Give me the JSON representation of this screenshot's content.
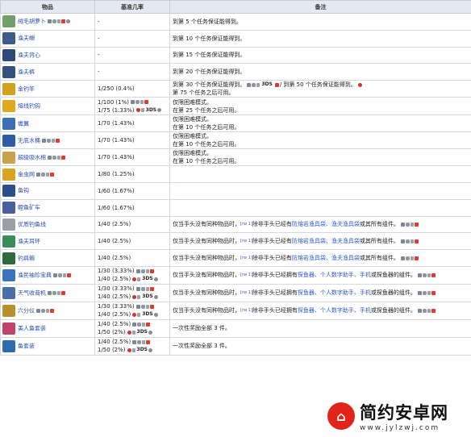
{
  "headers": {
    "item": "物品",
    "rate": "基准几率",
    "notes": "备注"
  },
  "rows": [
    {
      "name": "绒毛胡萝卜",
      "sprite_color": "#6fa06a",
      "plats": [
        "pc",
        "con",
        "mob",
        "sw",
        "gear"
      ],
      "rate1": "-",
      "note1": "到第 5 个任务保证能得到。"
    },
    {
      "name": "渔夫帽",
      "sprite_color": "#3d5a8c",
      "plats": [],
      "rate1": "-",
      "note1": "到第 10 个任务保证能得到。"
    },
    {
      "name": "渔夫背心",
      "sprite_color": "#2f4a7a",
      "plats": [],
      "rate1": "-",
      "note1": "到第 15 个任务保证能得到。"
    },
    {
      "name": "渔夫裤",
      "sprite_color": "#34507e",
      "plats": [],
      "rate1": "-",
      "note1": "到第 20 个任务保证能得到。"
    },
    {
      "name": "金钓竿",
      "sprite_color": "#d4a11c",
      "plats": [],
      "rate1": "1/250 (0.4%)",
      "note1": "到第 30 个任务保证能得到。",
      "note1b": "/ 到第 50 个任务保证能得到。",
      "note2": "第 75 个任务之后可用。"
    },
    {
      "name": "熔线钓钩",
      "sprite_color": "#e0a820",
      "plats": [],
      "rate1": "1/100 (1%)",
      "rate2": "1/75 (1.33%)",
      "note1": "仅限困难模式。",
      "note2": "在第 25 个任务之后可用。"
    },
    {
      "name": "蟾翼",
      "sprite_color": "#3c6fb8",
      "plats": [],
      "rate1": "1/70 (1.43%)",
      "note1": "仅限困难模式。",
      "note2": "在第 10 个任务之后可用。"
    },
    {
      "name": "无底水桶",
      "sprite_color": "#2d5ba8",
      "plats": [
        "pc",
        "con",
        "mob",
        "sw"
      ],
      "rate1": "1/70 (1.43%)",
      "note1": "仅限困难模式。",
      "note2": "在第 10 个任务之后可用。"
    },
    {
      "name": "超级吸水棉",
      "sprite_color": "#c9a24a",
      "plats": [
        "pc",
        "con",
        "mob",
        "sw"
      ],
      "rate1": "1/70 (1.43%)",
      "note1": "仅限困难模式。",
      "note2": "在第 10 个任务之后可用。"
    },
    {
      "name": "金虫网",
      "sprite_color": "#d9a520",
      "plats": [
        "pc",
        "con",
        "mob",
        "sw"
      ],
      "rate1": "1/80 (1.25%)"
    },
    {
      "name": "鱼钩",
      "sprite_color": "#2b4f8a",
      "plats": [],
      "rate1": "1/60 (1.67%)"
    },
    {
      "name": "鲤鱼矿车",
      "sprite_color": "#4a5fa0",
      "plats": [],
      "rate1": "1/60 (1.67%)"
    },
    {
      "name": "优质钓鱼线",
      "sprite_color": "#9aa0a6",
      "plats": [],
      "rate1": "1/40 (2.5%)",
      "note1": "仅当手头没有同种物品时，",
      "note_sup": "[rw 1]",
      "note_mid": "除非手头已经有",
      "note_link": "防熔岩渔具袋、渔夫渔具袋",
      "note_tail": "或其所有组件。"
    },
    {
      "name": "渔夫耳环",
      "sprite_color": "#3b8c5a",
      "plats": [],
      "rate1": "1/40 (2.5%)",
      "note1": "仅当手头没有同种物品时，",
      "note_sup": "[rw 1]",
      "note_mid": "除非手头已经有",
      "note_link": "防熔岩渔具袋、渔夫渔具袋",
      "note_tail": "或其所有组件。"
    },
    {
      "name": "钓具箱",
      "sprite_color": "#2e6b3c",
      "plats": [],
      "rate1": "1/40 (2.5%)",
      "note1": "仅当手头没有同种物品时，",
      "note_sup": "[rw 1]",
      "note_mid": "除非手头已经有",
      "note_link": "防熔岩渔具袋、渔夫渔具袋",
      "note_tail": "或其所有组件。"
    },
    {
      "name": "渔民袖珍宝典",
      "sprite_color": "#3a74c0",
      "plats": [
        "pc",
        "con",
        "mob",
        "sw"
      ],
      "rate1": "1/30 (3.33%)",
      "rate2": "1/40 (2.5%)",
      "note1": "仅当手头没有同种物品时，",
      "note_sup": "[rw 1]",
      "note_mid": "除非手头已经拥有",
      "note_link": "探鱼器、个人数字助手、手机",
      "note_tail": "或探鱼器的组件。"
    },
    {
      "name": "天气收音机",
      "sprite_color": "#4a6fa8",
      "plats": [
        "pc",
        "con",
        "mob",
        "sw"
      ],
      "rate1": "1/30 (3.33%)",
      "rate2": "1/40 (2.5%)",
      "note1": "仅当手头没有同种物品时，",
      "note_sup": "[rw 1]",
      "note_mid": "除非手头已经拥有",
      "note_link": "探鱼器、个人数字助手、手机",
      "note_tail": "或探鱼器的组件。"
    },
    {
      "name": "六分仪",
      "sprite_color": "#b8902c",
      "plats": [
        "pc",
        "con",
        "mob",
        "sw"
      ],
      "rate1": "1/30 (3.33%)",
      "rate2": "1/40 (2.5%)",
      "note1": "仅当手头没有同种物品时，",
      "note_sup": "[rw 1]",
      "note_mid": "除非手头已经拥有",
      "note_link": "探鱼器、个人数字助手、手机",
      "note_tail": "或探鱼器的组件。"
    },
    {
      "name": "美人鱼套装",
      "sprite_color": "#c0446a",
      "plats": [],
      "rate1": "1/40 (2.5%)",
      "rate2": "1/50 (2%)",
      "note1": "一次性奖励全部 3 件。"
    },
    {
      "name": "鱼套装",
      "sprite_color": "#2f6bb0",
      "plats": [],
      "rate1": "1/40 (2.5%)",
      "rate2": "1/50 (2%)",
      "note1": "一次性奖励全部 3 件。"
    }
  ],
  "platform_label_3ds": "3DS",
  "watermark": {
    "title": "简约安卓网",
    "url": "www.jylzwj.com"
  }
}
